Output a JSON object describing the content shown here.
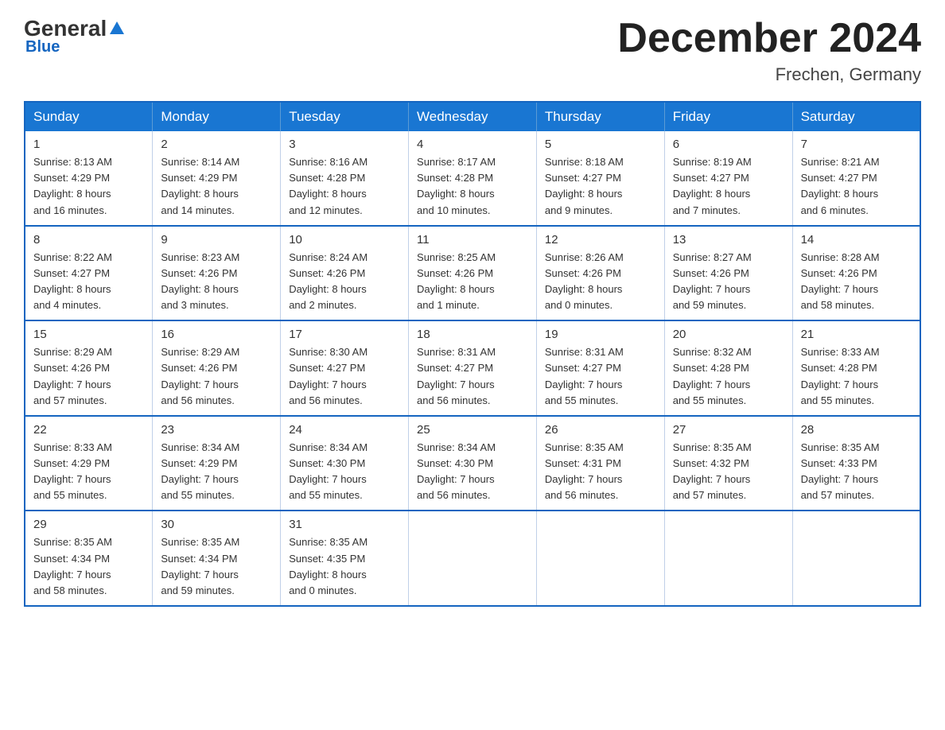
{
  "logo": {
    "general": "General",
    "blue": "Blue"
  },
  "title": "December 2024",
  "location": "Frechen, Germany",
  "days_of_week": [
    "Sunday",
    "Monday",
    "Tuesday",
    "Wednesday",
    "Thursday",
    "Friday",
    "Saturday"
  ],
  "weeks": [
    [
      {
        "day": "1",
        "info": "Sunrise: 8:13 AM\nSunset: 4:29 PM\nDaylight: 8 hours\nand 16 minutes."
      },
      {
        "day": "2",
        "info": "Sunrise: 8:14 AM\nSunset: 4:29 PM\nDaylight: 8 hours\nand 14 minutes."
      },
      {
        "day": "3",
        "info": "Sunrise: 8:16 AM\nSunset: 4:28 PM\nDaylight: 8 hours\nand 12 minutes."
      },
      {
        "day": "4",
        "info": "Sunrise: 8:17 AM\nSunset: 4:28 PM\nDaylight: 8 hours\nand 10 minutes."
      },
      {
        "day": "5",
        "info": "Sunrise: 8:18 AM\nSunset: 4:27 PM\nDaylight: 8 hours\nand 9 minutes."
      },
      {
        "day": "6",
        "info": "Sunrise: 8:19 AM\nSunset: 4:27 PM\nDaylight: 8 hours\nand 7 minutes."
      },
      {
        "day": "7",
        "info": "Sunrise: 8:21 AM\nSunset: 4:27 PM\nDaylight: 8 hours\nand 6 minutes."
      }
    ],
    [
      {
        "day": "8",
        "info": "Sunrise: 8:22 AM\nSunset: 4:27 PM\nDaylight: 8 hours\nand 4 minutes."
      },
      {
        "day": "9",
        "info": "Sunrise: 8:23 AM\nSunset: 4:26 PM\nDaylight: 8 hours\nand 3 minutes."
      },
      {
        "day": "10",
        "info": "Sunrise: 8:24 AM\nSunset: 4:26 PM\nDaylight: 8 hours\nand 2 minutes."
      },
      {
        "day": "11",
        "info": "Sunrise: 8:25 AM\nSunset: 4:26 PM\nDaylight: 8 hours\nand 1 minute."
      },
      {
        "day": "12",
        "info": "Sunrise: 8:26 AM\nSunset: 4:26 PM\nDaylight: 8 hours\nand 0 minutes."
      },
      {
        "day": "13",
        "info": "Sunrise: 8:27 AM\nSunset: 4:26 PM\nDaylight: 7 hours\nand 59 minutes."
      },
      {
        "day": "14",
        "info": "Sunrise: 8:28 AM\nSunset: 4:26 PM\nDaylight: 7 hours\nand 58 minutes."
      }
    ],
    [
      {
        "day": "15",
        "info": "Sunrise: 8:29 AM\nSunset: 4:26 PM\nDaylight: 7 hours\nand 57 minutes."
      },
      {
        "day": "16",
        "info": "Sunrise: 8:29 AM\nSunset: 4:26 PM\nDaylight: 7 hours\nand 56 minutes."
      },
      {
        "day": "17",
        "info": "Sunrise: 8:30 AM\nSunset: 4:27 PM\nDaylight: 7 hours\nand 56 minutes."
      },
      {
        "day": "18",
        "info": "Sunrise: 8:31 AM\nSunset: 4:27 PM\nDaylight: 7 hours\nand 56 minutes."
      },
      {
        "day": "19",
        "info": "Sunrise: 8:31 AM\nSunset: 4:27 PM\nDaylight: 7 hours\nand 55 minutes."
      },
      {
        "day": "20",
        "info": "Sunrise: 8:32 AM\nSunset: 4:28 PM\nDaylight: 7 hours\nand 55 minutes."
      },
      {
        "day": "21",
        "info": "Sunrise: 8:33 AM\nSunset: 4:28 PM\nDaylight: 7 hours\nand 55 minutes."
      }
    ],
    [
      {
        "day": "22",
        "info": "Sunrise: 8:33 AM\nSunset: 4:29 PM\nDaylight: 7 hours\nand 55 minutes."
      },
      {
        "day": "23",
        "info": "Sunrise: 8:34 AM\nSunset: 4:29 PM\nDaylight: 7 hours\nand 55 minutes."
      },
      {
        "day": "24",
        "info": "Sunrise: 8:34 AM\nSunset: 4:30 PM\nDaylight: 7 hours\nand 55 minutes."
      },
      {
        "day": "25",
        "info": "Sunrise: 8:34 AM\nSunset: 4:30 PM\nDaylight: 7 hours\nand 56 minutes."
      },
      {
        "day": "26",
        "info": "Sunrise: 8:35 AM\nSunset: 4:31 PM\nDaylight: 7 hours\nand 56 minutes."
      },
      {
        "day": "27",
        "info": "Sunrise: 8:35 AM\nSunset: 4:32 PM\nDaylight: 7 hours\nand 57 minutes."
      },
      {
        "day": "28",
        "info": "Sunrise: 8:35 AM\nSunset: 4:33 PM\nDaylight: 7 hours\nand 57 minutes."
      }
    ],
    [
      {
        "day": "29",
        "info": "Sunrise: 8:35 AM\nSunset: 4:34 PM\nDaylight: 7 hours\nand 58 minutes."
      },
      {
        "day": "30",
        "info": "Sunrise: 8:35 AM\nSunset: 4:34 PM\nDaylight: 7 hours\nand 59 minutes."
      },
      {
        "day": "31",
        "info": "Sunrise: 8:35 AM\nSunset: 4:35 PM\nDaylight: 8 hours\nand 0 minutes."
      },
      {
        "day": "",
        "info": ""
      },
      {
        "day": "",
        "info": ""
      },
      {
        "day": "",
        "info": ""
      },
      {
        "day": "",
        "info": ""
      }
    ]
  ]
}
